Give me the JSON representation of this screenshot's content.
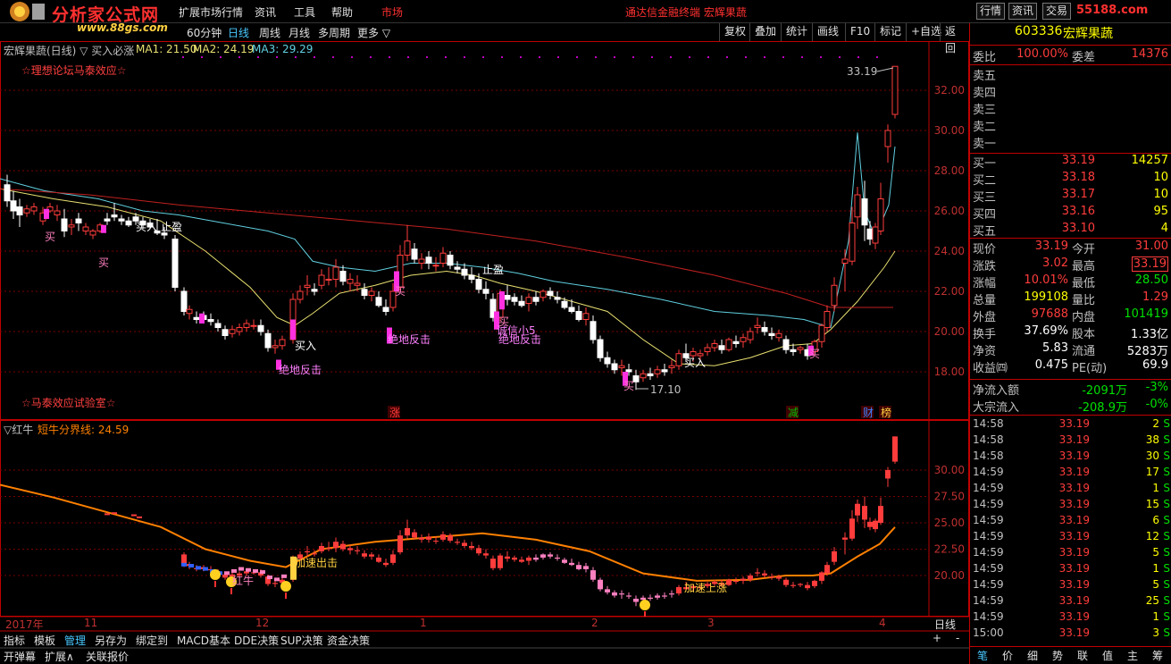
{
  "app": {
    "logo_text": "分析家公式网",
    "logo_url": "www.88gs.com",
    "menus": [
      "扩展市场行情",
      "资讯",
      "工具",
      "帮助",
      "市场"
    ],
    "banner": "通达信金融终端 宏辉果蔬",
    "win_buttons": [
      "行情",
      "资讯",
      "交易",
      "55188.com"
    ]
  },
  "toolbar": {
    "left_tabs": [
      "60分钟",
      "日线",
      "周线",
      "月线",
      "多周期",
      "更多 ▽"
    ],
    "active": "日线",
    "buttons": [
      "复权",
      "叠加",
      "统计",
      "画线",
      "F10",
      "标记",
      "+自选",
      "返回"
    ]
  },
  "main_chart": {
    "header": "宏辉果蔬(日线) ▽ 买入必涨",
    "ma1": "MA1: 21.50",
    "ma2": "MA2: 24.19",
    "ma3": "MA3: 29.29",
    "top_label": "☆理想论坛马泰效应☆",
    "bottom_label": "☆马泰效应试验室☆",
    "y_ticks": [
      "32.00",
      "30.00",
      "28.00",
      "26.00",
      "24.00",
      "22.00",
      "20.00",
      "18.00"
    ],
    "high_label": "33.19",
    "low_label": "17.10",
    "annotations": [
      "买",
      "买",
      "买入",
      "止盈",
      "买入",
      "绝地反击",
      "买",
      "绝地反击",
      "止盈",
      "买",
      "诚信小5",
      "绝地反击",
      "买",
      "买入",
      "买"
    ],
    "event_tags": [
      "涨",
      "减",
      "财",
      "榜"
    ]
  },
  "sub_chart": {
    "header": "▽红牛",
    "line_label": "短牛分界线: 24.59",
    "y_ticks": [
      "30.00",
      "27.50",
      "25.00",
      "22.50",
      "20.00"
    ],
    "annotations": [
      "红牛",
      "加速出击",
      "加速上涨"
    ]
  },
  "x_axis": {
    "labels": [
      "2017年",
      "11",
      "12",
      "1",
      "2",
      "3",
      "4"
    ],
    "period": "日线"
  },
  "bottom_tabs": {
    "row1": [
      "指标",
      "模板",
      "管理",
      "另存为",
      "绑定到",
      "MACD基本",
      "DDE决策",
      "SUP决策",
      "资金决策"
    ],
    "row2": [
      "开弹幕",
      "扩展∧",
      "关联报价"
    ],
    "active": "管理"
  },
  "quote": {
    "code": "603336",
    "name": "宏辉果蔬",
    "wb_label": "委比",
    "wb": "100.00%",
    "wc_label": "委差",
    "wc": "14376",
    "sell": [
      {
        "label": "卖五",
        "price": "",
        "vol": ""
      },
      {
        "label": "卖四",
        "price": "",
        "vol": ""
      },
      {
        "label": "卖三",
        "price": "",
        "vol": ""
      },
      {
        "label": "卖二",
        "price": "",
        "vol": ""
      },
      {
        "label": "卖一",
        "price": "",
        "vol": ""
      }
    ],
    "buy": [
      {
        "label": "买一",
        "price": "33.19",
        "vol": "14257"
      },
      {
        "label": "买二",
        "price": "33.18",
        "vol": "10"
      },
      {
        "label": "买三",
        "price": "33.17",
        "vol": "10"
      },
      {
        "label": "买四",
        "price": "33.16",
        "vol": "95"
      },
      {
        "label": "买五",
        "price": "33.10",
        "vol": "4"
      }
    ],
    "stats": [
      {
        "l1": "现价",
        "v1": "33.19",
        "l2": "今开",
        "v2": "31.00",
        "c1": "red",
        "c2": "red"
      },
      {
        "l1": "涨跌",
        "v1": "3.02",
        "l2": "最高",
        "v2": "33.19",
        "c1": "red",
        "c2": "red"
      },
      {
        "l1": "涨幅",
        "v1": "10.01%",
        "l2": "最低",
        "v2": "28.50",
        "c1": "red",
        "c2": "grn"
      },
      {
        "l1": "总量",
        "v1": "199108",
        "l2": "量比",
        "v2": "1.29",
        "c1": "yel",
        "c2": "red"
      },
      {
        "l1": "外盘",
        "v1": "97688",
        "l2": "内盘",
        "v2": "101419",
        "c1": "red",
        "c2": "grn"
      },
      {
        "l1": "换手",
        "v1": "37.69%",
        "l2": "股本",
        "v2": "1.33亿",
        "c1": "wht",
        "c2": "wht"
      },
      {
        "l1": "净资",
        "v1": "5.83",
        "l2": "流通",
        "v2": "5283万",
        "c1": "wht",
        "c2": "wht"
      },
      {
        "l1": "收益㈣",
        "v1": "0.475",
        "l2": "PE(动)",
        "v2": "69.9",
        "c1": "wht",
        "c2": "wht"
      }
    ],
    "flow": [
      {
        "label": "净流入额",
        "value": "-2091万",
        "pct": "-3%"
      },
      {
        "label": "大宗流入",
        "value": "-208.9万",
        "pct": "-0%"
      }
    ],
    "ticks": [
      {
        "t": "14:58",
        "p": "33.19",
        "v": "2",
        "s": "S"
      },
      {
        "t": "14:58",
        "p": "33.19",
        "v": "38",
        "s": "S"
      },
      {
        "t": "14:58",
        "p": "33.19",
        "v": "30",
        "s": "S"
      },
      {
        "t": "14:59",
        "p": "33.19",
        "v": "17",
        "s": "S"
      },
      {
        "t": "14:59",
        "p": "33.19",
        "v": "1",
        "s": "S"
      },
      {
        "t": "14:59",
        "p": "33.19",
        "v": "15",
        "s": "S"
      },
      {
        "t": "14:59",
        "p": "33.19",
        "v": "6",
        "s": "S"
      },
      {
        "t": "14:59",
        "p": "33.19",
        "v": "12",
        "s": "S"
      },
      {
        "t": "14:59",
        "p": "33.19",
        "v": "5",
        "s": "S"
      },
      {
        "t": "14:59",
        "p": "33.19",
        "v": "1",
        "s": "S"
      },
      {
        "t": "14:59",
        "p": "33.19",
        "v": "5",
        "s": "S"
      },
      {
        "t": "14:59",
        "p": "33.19",
        "v": "25",
        "s": "S"
      },
      {
        "t": "14:59",
        "p": "33.19",
        "v": "1",
        "s": "S"
      },
      {
        "t": "15:00",
        "p": "33.19",
        "v": "3",
        "s": "S"
      }
    ],
    "bottom_tabs": [
      "笔",
      "价",
      "细",
      "势",
      "联",
      "值",
      "主",
      "筹"
    ]
  },
  "colors": {
    "up": "#ff3c3c",
    "down": "#ffffff",
    "ma_yellow": "#e8e070",
    "ma_cyan": "#60d0e0",
    "ma_red": "#c02020",
    "orange": "#ff8000",
    "pink": "#ff80c0",
    "magenta": "#ff00ff",
    "frame": "#c00000"
  }
}
